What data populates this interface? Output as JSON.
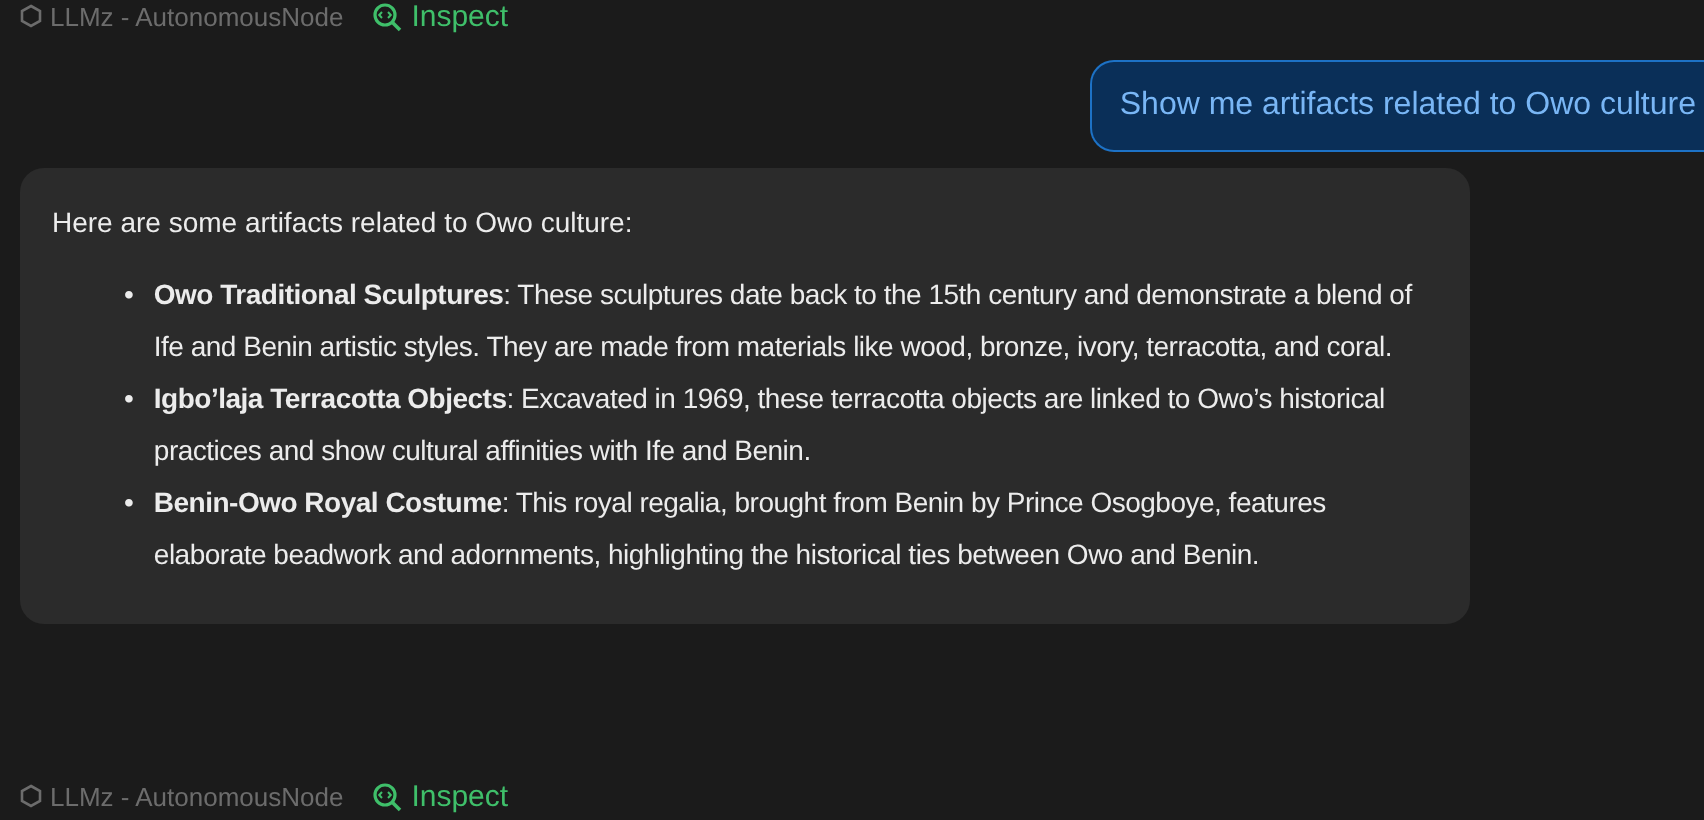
{
  "messages": [
    {
      "kind": "meta",
      "node": "LLMz - AutonomousNode",
      "action": "Inspect"
    },
    {
      "kind": "user",
      "text": "Show me artifacts related to Owo culture"
    },
    {
      "kind": "assistant",
      "intro": "Here are some artifacts related to Owo culture:",
      "items": [
        {
          "marker": "•",
          "text": "**Owo Traditional Sculptures**: These sculptures date back to the 15th century and demonstrate a blend of Ife and Benin artistic styles. They are made from materials like wood, bronze, ivory, terracotta, and coral."
        },
        {
          "marker": "•",
          "text": "**Igbo’laja Terracotta Objects**: Excavated in 1969, these terracotta objects are linked to Owo’s historical practices and show cultural affinities with Ife and Benin."
        },
        {
          "marker": "•",
          "text": "**Benin-Owo Royal Costume**: This royal regalia, brought from Benin by Prince Osogboye, features elaborate beadwork and adornments, highlighting the historical ties between Owo and Benin."
        }
      ]
    },
    {
      "kind": "meta",
      "node": "LLMz - AutonomousNode",
      "action": "Inspect"
    }
  ]
}
